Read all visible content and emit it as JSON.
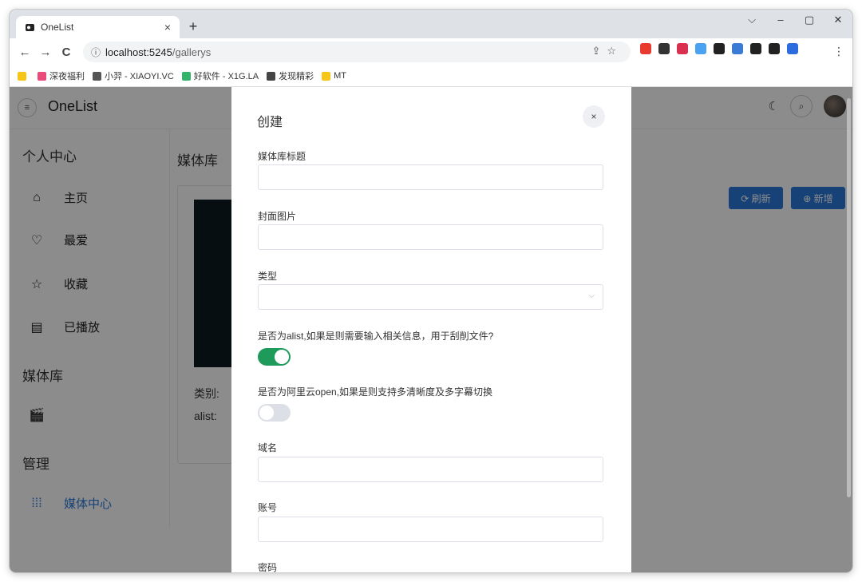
{
  "browser": {
    "tab_title": "OneList",
    "tab_close": "×",
    "new_tab": "+",
    "window_controls": [
      "⌵",
      "–",
      "▢",
      "✕"
    ],
    "nav": {
      "back": "←",
      "forward": "→",
      "reload": "C"
    },
    "url_info_icon": "ⓘ",
    "url_host": "localhost:5245",
    "url_path": "/gallerys",
    "menu": "⋮",
    "extension_colors": [
      "#e83a2f",
      "#333333",
      "#d9304f",
      "#4aa3f0",
      "#222222",
      "#3a7bd5",
      "#222222",
      "#222222",
      "#2d6cdf"
    ],
    "bookmarks": [
      {
        "label": "",
        "color": "#f5c518"
      },
      {
        "label": "深夜福利",
        "color": "#e84a7a"
      },
      {
        "label": "小羿 - XIAOYI.VC",
        "color": "#555555"
      },
      {
        "label": "好软件 - X1G.LA",
        "color": "#34b36b"
      },
      {
        "label": "发现精彩",
        "color": "#444444"
      },
      {
        "label": "MT",
        "color": "#f5c518"
      }
    ]
  },
  "app": {
    "brand": "OneList",
    "menu_icon": "≡",
    "theme_icon": "☾",
    "search_icon": "⌕",
    "sidebar": {
      "section_personal": "个人中心",
      "items": [
        {
          "icon": "⌂",
          "label": "主页"
        },
        {
          "icon": "♡",
          "label": "最爱"
        },
        {
          "icon": "☆",
          "label": "收藏"
        },
        {
          "icon": "▤",
          "label": "已播放"
        }
      ],
      "section_media": "媒体库",
      "media_icon": "🎬",
      "section_manage": "管理",
      "manage_item": {
        "icon": "⁞⁞⁞",
        "label": "媒体中心"
      }
    },
    "main": {
      "title": "媒体库",
      "refresh_button": "⟳ 刷新",
      "add_button": "⊕ 新增",
      "card_category": "类别:",
      "card_alist": "alist: ‌"
    }
  },
  "modal": {
    "title": "创建",
    "close": "×",
    "fields": {
      "title_label": "媒体库标题",
      "title_value": "",
      "cover_label": "封面图片",
      "cover_value": "",
      "type_label": "类型",
      "type_value": "",
      "type_arrow": "⌵",
      "alist_label": "是否为alist,如果是则需要输入相关信息，用于刮削文件?",
      "alist_on": true,
      "aliyun_label": "是否为阿里云open,如果是则支持多清晰度及多字幕切换",
      "aliyun_on": false,
      "domain_label": "域名",
      "domain_value": "",
      "account_label": "账号",
      "account_value": "",
      "password_label": "密码"
    }
  },
  "colors": {
    "primary": "#2b78d9",
    "toggle_on": "#1e9b5a",
    "toggle_off": "#dcdfe6"
  }
}
